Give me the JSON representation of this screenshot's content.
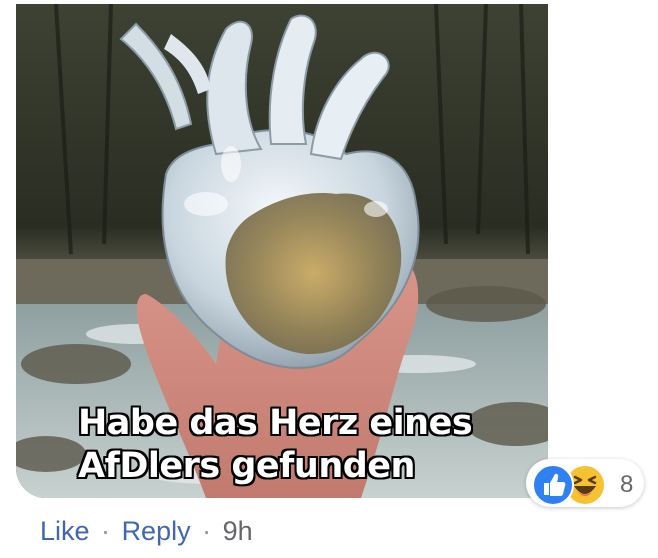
{
  "post": {
    "caption_line1": "Habe das Herz eines",
    "caption_line2": "AfDlers gefunden"
  },
  "reactions": {
    "icons": [
      "like-icon",
      "haha-icon"
    ],
    "count": "8",
    "colors": {
      "like": "#2f80f0",
      "haha": "#f6c232"
    }
  },
  "actions": {
    "like_label": "Like",
    "separator": "·",
    "reply_label": "Reply",
    "time": "9h"
  }
}
